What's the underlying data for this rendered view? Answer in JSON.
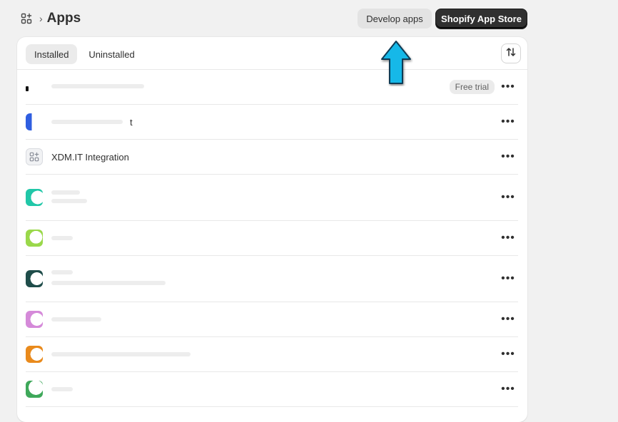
{
  "header": {
    "breadcrumb_icon": "apps-grid-icon",
    "chevron": "›",
    "title": "Apps",
    "develop_apps_label": "Develop apps",
    "app_store_label": "Shopify App Store"
  },
  "tabs": [
    {
      "label": "Installed",
      "active": true
    },
    {
      "label": "Uninstalled",
      "active": false
    }
  ],
  "sort_icon": "sort-arrows-icon",
  "apps": [
    {
      "name": "",
      "badge": "Free trial",
      "icon_color": "#111111"
    },
    {
      "name": "t",
      "badge": "",
      "icon_color": "#2f5ee0"
    },
    {
      "name": "XDM.IT Integration",
      "badge": "",
      "icon_color": "#8a8f99"
    },
    {
      "name": "",
      "badge": "",
      "icon_color": "#21c7a8"
    },
    {
      "name": "",
      "badge": "",
      "icon_color": "#9ad84a"
    },
    {
      "name": "",
      "badge": "",
      "icon_color": "#1f4d4a"
    },
    {
      "name": "",
      "badge": "",
      "icon_color": "#d58ad9"
    },
    {
      "name": "",
      "badge": "",
      "icon_color": "#e98a1c"
    },
    {
      "name": "",
      "badge": "",
      "icon_color": "#3ea85a"
    }
  ],
  "more_label": "•••",
  "colors": {
    "background": "#f1f1f1",
    "primary_button": "#303030",
    "arrow_fill": "#15b8e8"
  }
}
